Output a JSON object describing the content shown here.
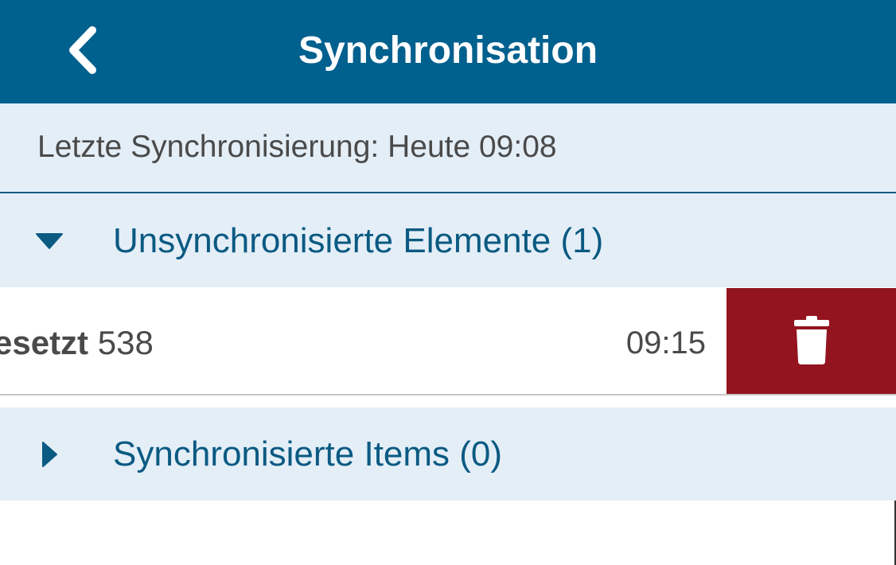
{
  "header": {
    "title": "Synchronisation",
    "back_icon": "chevron-left-icon",
    "background_color": "#00608e"
  },
  "last_sync": {
    "text": "Letzte Synchronisierung: Heute 09:08"
  },
  "sections": {
    "unsynced": {
      "label": "Unsynchronisierte Elemente (1)",
      "expanded": true,
      "icon": "caret-down-icon",
      "items": [
        {
          "title_bold": "esetzt",
          "title_number": "538",
          "time": "09:15",
          "delete_icon": "trash-icon"
        }
      ]
    },
    "synced": {
      "label": "Synchronisierte Items (0)",
      "expanded": false,
      "icon": "caret-right-icon"
    }
  },
  "colors": {
    "accent": "#0a5a82",
    "section_background": "#e4eef7",
    "delete": "#93141f"
  }
}
